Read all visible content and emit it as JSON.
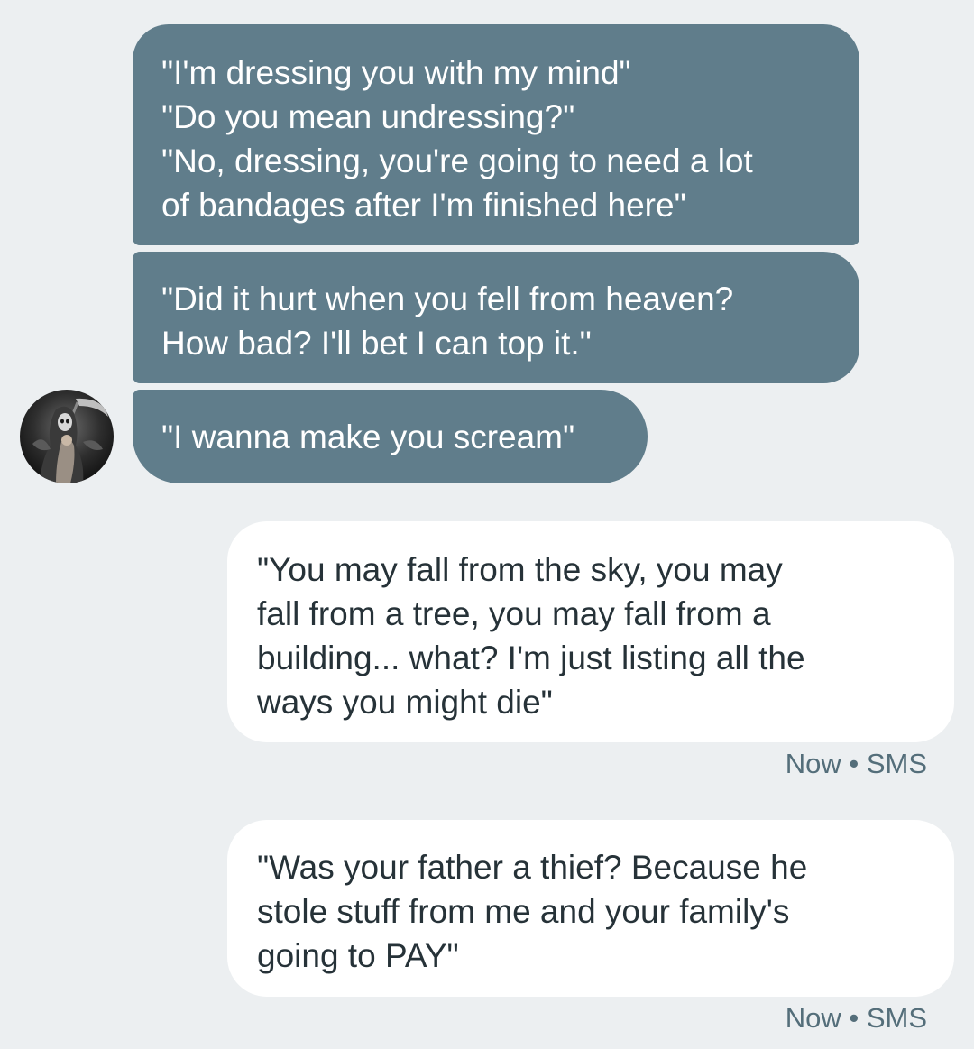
{
  "conversation": {
    "incoming": [
      {
        "text": "\"I'm dressing you with my mind\"\n\"Do you mean undressing?\"\n\"No, dressing, you're going to need a lot\nof bandages after I'm finished here\""
      },
      {
        "text": "\"Did it hurt when you fell from heaven?\nHow bad? I'll bet I can top it.\""
      },
      {
        "text": "\"I wanna make you scream\""
      }
    ],
    "outgoing": [
      {
        "text": "\"You may fall from the sky, you may\nfall from a tree, you may fall from a\nbuilding... what? I'm just listing all the\nways you might die\"",
        "time": "Now",
        "separator": "•",
        "channel": "SMS"
      },
      {
        "text": "\"Was your father a thief? Because he\nstole stuff from me and your family's\ngoing to PAY\"",
        "time": "Now",
        "separator": "•",
        "channel": "SMS"
      }
    ]
  },
  "colors": {
    "background": "#eceff1",
    "incoming_bubble": "#607d8b",
    "incoming_text": "#ffffff",
    "outgoing_bubble": "#ffffff",
    "outgoing_text": "#263238",
    "meta_text": "#546e7a"
  },
  "avatar": {
    "icon": "grim-reaper-avatar-icon"
  }
}
